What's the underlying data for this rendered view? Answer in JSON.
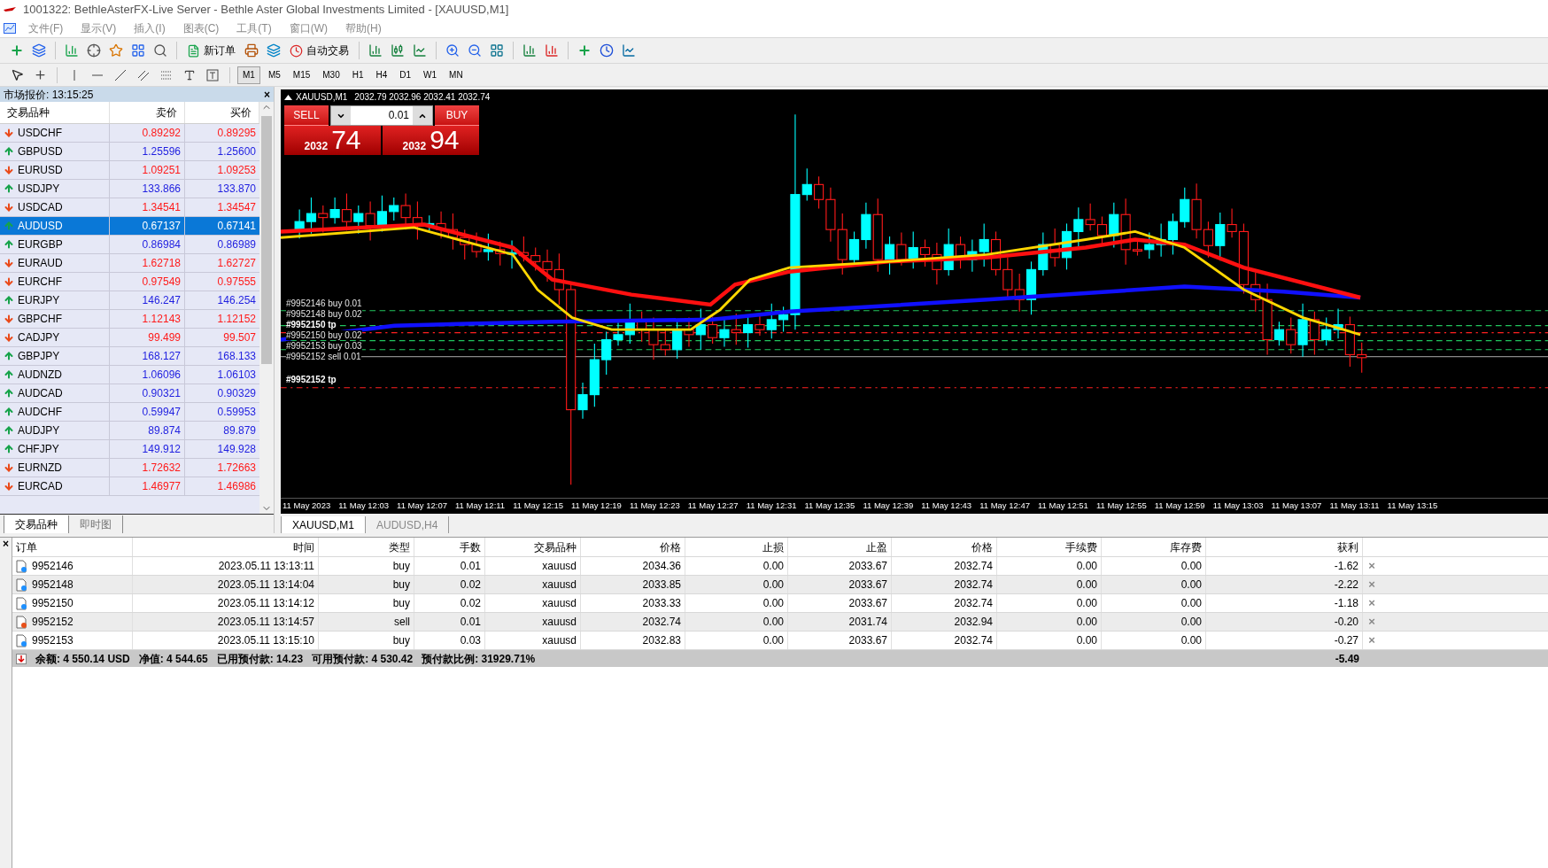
{
  "window": {
    "title": "1001322: BethleAsterFX-Live Server - Bethle Aster Global Investments Limited - [XAUUSD,M1]"
  },
  "menu": [
    "文件(F)",
    "显示(V)",
    "插入(I)",
    "图表(C)",
    "工具(T)",
    "窗口(W)",
    "帮助(H)"
  ],
  "toolbar": {
    "new_order": "新订单",
    "auto_trading": "自动交易"
  },
  "timeframes": [
    {
      "label": "M1",
      "selected": true
    },
    {
      "label": "M5",
      "selected": false
    },
    {
      "label": "M15",
      "selected": false
    },
    {
      "label": "M30",
      "selected": false
    },
    {
      "label": "H1",
      "selected": false
    },
    {
      "label": "H4",
      "selected": false
    },
    {
      "label": "D1",
      "selected": false
    },
    {
      "label": "W1",
      "selected": false
    },
    {
      "label": "MN",
      "selected": false
    }
  ],
  "market_watch": {
    "title": "市场报价: 13:15:25",
    "close": "×",
    "columns": [
      "交易品种",
      "卖价",
      "买价"
    ],
    "rows": [
      {
        "symbol": "USDCHF",
        "bid": "0.89292",
        "ask": "0.89295",
        "rising": false,
        "selected": false
      },
      {
        "symbol": "GBPUSD",
        "bid": "1.25596",
        "ask": "1.25600",
        "rising": true,
        "selected": false
      },
      {
        "symbol": "EURUSD",
        "bid": "1.09251",
        "ask": "1.09253",
        "rising": false,
        "selected": false
      },
      {
        "symbol": "USDJPY",
        "bid": "133.866",
        "ask": "133.870",
        "rising": true,
        "selected": false
      },
      {
        "symbol": "USDCAD",
        "bid": "1.34541",
        "ask": "1.34547",
        "rising": false,
        "selected": false
      },
      {
        "symbol": "AUDUSD",
        "bid": "0.67137",
        "ask": "0.67141",
        "rising": true,
        "selected": true
      },
      {
        "symbol": "EURGBP",
        "bid": "0.86984",
        "ask": "0.86989",
        "rising": true,
        "selected": false
      },
      {
        "symbol": "EURAUD",
        "bid": "1.62718",
        "ask": "1.62727",
        "rising": false,
        "selected": false
      },
      {
        "symbol": "EURCHF",
        "bid": "0.97549",
        "ask": "0.97555",
        "rising": false,
        "selected": false
      },
      {
        "symbol": "EURJPY",
        "bid": "146.247",
        "ask": "146.254",
        "rising": true,
        "selected": false
      },
      {
        "symbol": "GBPCHF",
        "bid": "1.12143",
        "ask": "1.12152",
        "rising": false,
        "selected": false
      },
      {
        "symbol": "CADJPY",
        "bid": "99.499",
        "ask": "99.507",
        "rising": false,
        "selected": false
      },
      {
        "symbol": "GBPJPY",
        "bid": "168.127",
        "ask": "168.133",
        "rising": true,
        "selected": false
      },
      {
        "symbol": "AUDNZD",
        "bid": "1.06096",
        "ask": "1.06103",
        "rising": true,
        "selected": false
      },
      {
        "symbol": "AUDCAD",
        "bid": "0.90321",
        "ask": "0.90329",
        "rising": true,
        "selected": false
      },
      {
        "symbol": "AUDCHF",
        "bid": "0.59947",
        "ask": "0.59953",
        "rising": true,
        "selected": false
      },
      {
        "symbol": "AUDJPY",
        "bid": "89.874",
        "ask": "89.879",
        "rising": true,
        "selected": false
      },
      {
        "symbol": "CHFJPY",
        "bid": "149.912",
        "ask": "149.928",
        "rising": true,
        "selected": false
      },
      {
        "symbol": "EURNZD",
        "bid": "1.72632",
        "ask": "1.72663",
        "rising": false,
        "selected": false
      },
      {
        "symbol": "EURCAD",
        "bid": "1.46977",
        "ask": "1.46986",
        "rising": false,
        "selected": false
      }
    ],
    "tabs": [
      {
        "label": "交易品种",
        "selected": true
      },
      {
        "label": "即时图",
        "selected": false
      }
    ]
  },
  "chart": {
    "symbol": "XAUUSD,M1",
    "ohlc": "2032.79 2032.96 2032.41 2032.74",
    "trade_panel": {
      "sell": "SELL",
      "buy": "BUY",
      "lot": "0.01",
      "bid_big": "2032",
      "bid_small": "74",
      "ask_big": "2032",
      "ask_small": "94"
    },
    "order_labels": [
      {
        "text": "#9952146 buy 0.01",
        "take_profit": false
      },
      {
        "text": "#9952148 buy 0.02",
        "take_profit": false
      },
      {
        "text": "#9952150 tp",
        "take_profit": true
      },
      {
        "text": "#9952150 buy 0.02",
        "take_profit": false
      },
      {
        "text": "#9952153 buy 0.03",
        "take_profit": false
      },
      {
        "text": "#9952152 sell 0.01",
        "take_profit": false
      },
      {
        "text": "#9952152 tp",
        "take_profit": true
      }
    ],
    "time_labels": [
      "11 May 2023",
      "11 May 12:03",
      "11 May 12:07",
      "11 May 12:11",
      "11 May 12:15",
      "11 May 12:19",
      "11 May 12:23",
      "11 May 12:27",
      "11 May 12:31",
      "11 May 12:35",
      "11 May 12:39",
      "11 May 12:43",
      "11 May 12:47",
      "11 May 12:51",
      "11 May 12:55",
      "11 May 12:59",
      "11 May 13:03",
      "11 May 13:07",
      "11 May 13:11",
      "11 May 13:15"
    ],
    "tabs": [
      {
        "label": "XAUUSD,M1",
        "selected": true
      },
      {
        "label": "AUDUSD,H4",
        "selected": false
      }
    ]
  },
  "terminal": {
    "close": "×",
    "columns": [
      "订单",
      "时间",
      "类型",
      "手数",
      "交易品种",
      "价格",
      "止损",
      "止盈",
      "价格",
      "手续费",
      "库存费",
      "获利"
    ],
    "rows": [
      {
        "sell": false,
        "cells": [
          "9952146",
          "2023.05.11 13:13:11",
          "buy",
          "0.01",
          "xauusd",
          "2034.36",
          "0.00",
          "2033.67",
          "2032.74",
          "0.00",
          "0.00",
          "-1.62"
        ],
        "close": "×"
      },
      {
        "sell": false,
        "cells": [
          "9952148",
          "2023.05.11 13:14:04",
          "buy",
          "0.02",
          "xauusd",
          "2033.85",
          "0.00",
          "2033.67",
          "2032.74",
          "0.00",
          "0.00",
          "-2.22"
        ],
        "close": "×"
      },
      {
        "sell": false,
        "cells": [
          "9952150",
          "2023.05.11 13:14:12",
          "buy",
          "0.02",
          "xauusd",
          "2033.33",
          "0.00",
          "2033.67",
          "2032.74",
          "0.00",
          "0.00",
          "-1.18"
        ],
        "close": "×"
      },
      {
        "sell": true,
        "cells": [
          "9952152",
          "2023.05.11 13:14:57",
          "sell",
          "0.01",
          "xauusd",
          "2032.74",
          "0.00",
          "2031.74",
          "2032.94",
          "0.00",
          "0.00",
          "-0.20"
        ],
        "close": "×"
      },
      {
        "sell": false,
        "cells": [
          "9952153",
          "2023.05.11 13:15:10",
          "buy",
          "0.03",
          "xauusd",
          "2032.83",
          "0.00",
          "2033.67",
          "2032.74",
          "0.00",
          "0.00",
          "-0.27"
        ],
        "close": "×"
      }
    ],
    "summary": [
      "余额: 4 550.14 USD",
      "净值: 4 544.65",
      "已用预付款: 14.23",
      "可用预付款: 4 530.42",
      "预付款比例: 31929.71%"
    ],
    "total": "-5.49"
  }
}
